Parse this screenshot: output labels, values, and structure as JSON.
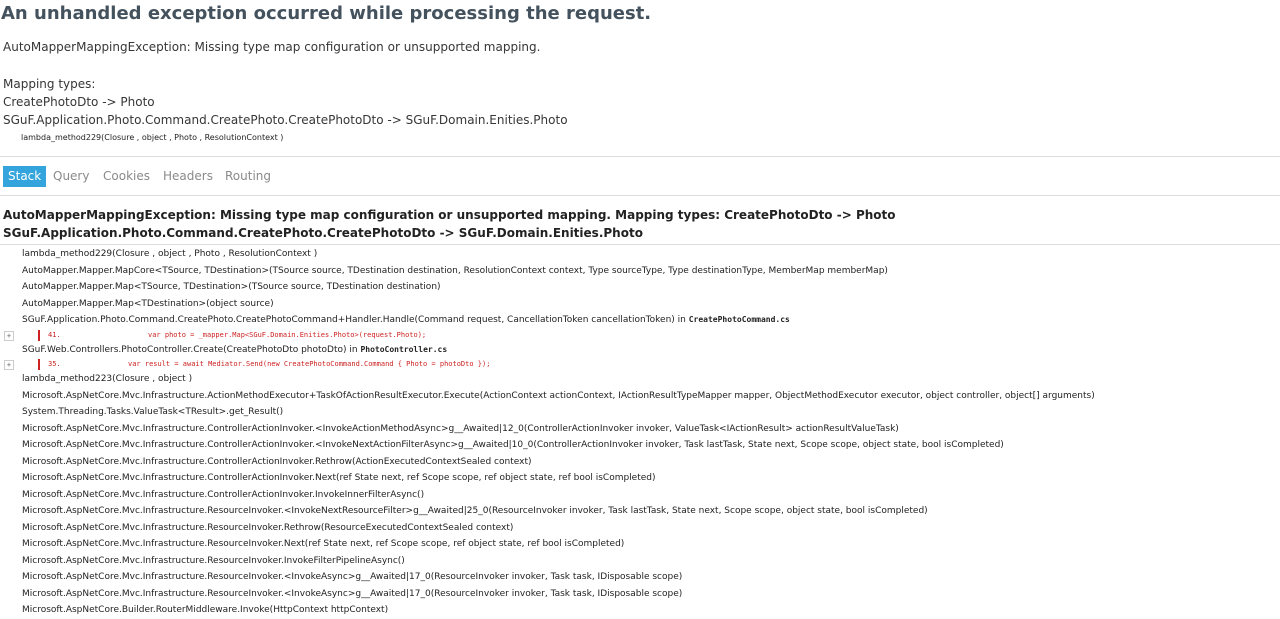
{
  "header": {
    "title": "An unhandled exception occurred while processing the request.",
    "error_message": "AutoMapperMappingException: Missing type map configuration or unsupported mapping.",
    "mapping_header": "Mapping types:",
    "mapping_line1": "CreatePhotoDto -> Photo",
    "mapping_line2": "SGuF.Application.Photo.Command.CreatePhoto.CreatePhotoDto -> SGuF.Domain.Enities.Photo",
    "location": "lambda_method229(Closure , object , Photo , ResolutionContext )"
  },
  "tabs": {
    "stack": "Stack",
    "query": "Query",
    "cookies": "Cookies",
    "headers": "Headers",
    "routing": "Routing"
  },
  "stack": {
    "title": "AutoMapperMappingException: Missing type map configuration or unsupported mapping. Mapping types: CreatePhotoDto -> Photo SGuF.Application.Photo.Command.CreatePhoto.CreatePhotoDto -> SGuF.Domain.Enities.Photo",
    "frame1": "lambda_method229(Closure , object , Photo , ResolutionContext )",
    "frame2": "AutoMapper.Mapper.MapCore<TSource, TDestination>(TSource source, TDestination destination, ResolutionContext context, Type sourceType, Type destinationType, MemberMap memberMap)",
    "frame3": "AutoMapper.Mapper.Map<TSource, TDestination>(TSource source, TDestination destination)",
    "frame4": "AutoMapper.Mapper.Map<TDestination>(object source)",
    "frame5": "SGuF.Application.Photo.Command.CreatePhoto.CreatePhotoCommand+Handler.Handle(Command request, CancellationToken cancellationToken) in ",
    "frame5_file": "CreatePhotoCommand.cs",
    "code5_lineno": "41.",
    "code5_text": "var photo = _mapper.Map<SGuF.Domain.Enities.Photo>(request.Photo);",
    "frame6": "SGuF.Web.Controllers.PhotoController.Create(CreatePhotoDto photoDto) in ",
    "frame6_file": "PhotoController.cs",
    "code6_lineno": "35.",
    "code6_text": "var result = await Mediator.Send(new CreatePhotoCommand.Command { Photo = photoDto });",
    "frame7": "lambda_method223(Closure , object )",
    "frame8": "Microsoft.AspNetCore.Mvc.Infrastructure.ActionMethodExecutor+TaskOfActionResultExecutor.Execute(ActionContext actionContext, IActionResultTypeMapper mapper, ObjectMethodExecutor executor, object controller, object[] arguments)",
    "frame9": "System.Threading.Tasks.ValueTask<TResult>.get_Result()",
    "frame10": "Microsoft.AspNetCore.Mvc.Infrastructure.ControllerActionInvoker.<InvokeActionMethodAsync>g__Awaited|12_0(ControllerActionInvoker invoker, ValueTask<IActionResult> actionResultValueTask)",
    "frame11": "Microsoft.AspNetCore.Mvc.Infrastructure.ControllerActionInvoker.<InvokeNextActionFilterAsync>g__Awaited|10_0(ControllerActionInvoker invoker, Task lastTask, State next, Scope scope, object state, bool isCompleted)",
    "frame12": "Microsoft.AspNetCore.Mvc.Infrastructure.ControllerActionInvoker.Rethrow(ActionExecutedContextSealed context)",
    "frame13": "Microsoft.AspNetCore.Mvc.Infrastructure.ControllerActionInvoker.Next(ref State next, ref Scope scope, ref object state, ref bool isCompleted)",
    "frame14": "Microsoft.AspNetCore.Mvc.Infrastructure.ControllerActionInvoker.InvokeInnerFilterAsync()",
    "frame15": "Microsoft.AspNetCore.Mvc.Infrastructure.ResourceInvoker.<InvokeNextResourceFilter>g__Awaited|25_0(ResourceInvoker invoker, Task lastTask, State next, Scope scope, object state, bool isCompleted)",
    "frame16": "Microsoft.AspNetCore.Mvc.Infrastructure.ResourceInvoker.Rethrow(ResourceExecutedContextSealed context)",
    "frame17": "Microsoft.AspNetCore.Mvc.Infrastructure.ResourceInvoker.Next(ref State next, ref Scope scope, ref object state, ref bool isCompleted)",
    "frame18": "Microsoft.AspNetCore.Mvc.Infrastructure.ResourceInvoker.InvokeFilterPipelineAsync()",
    "frame19": "Microsoft.AspNetCore.Mvc.Infrastructure.ResourceInvoker.<InvokeAsync>g__Awaited|17_0(ResourceInvoker invoker, Task task, IDisposable scope)",
    "frame20": "Microsoft.AspNetCore.Mvc.Infrastructure.ResourceInvoker.<InvokeAsync>g__Awaited|17_0(ResourceInvoker invoker, Task task, IDisposable scope)",
    "frame21": "Microsoft.AspNetCore.Builder.RouterMiddleware.Invoke(HttpContext httpContext)"
  },
  "icons": {
    "expander": "+"
  },
  "colors": {
    "title": "#44525e",
    "tab_selected_bg": "#33a4dc",
    "tab_text": "#8a8a8a",
    "code_error": "#cc2222",
    "divider": "#dddddd"
  }
}
